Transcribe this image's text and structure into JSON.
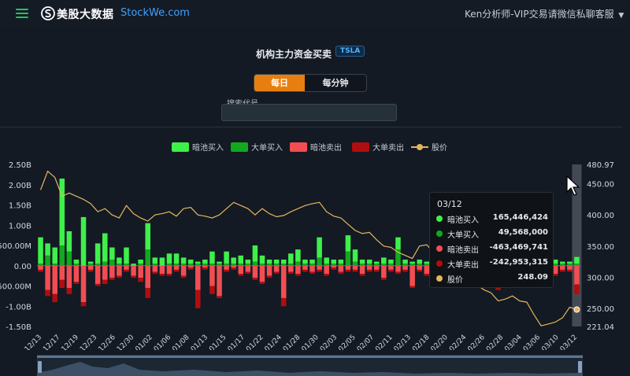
{
  "header": {
    "brand": "美股大数据",
    "site": "StockWe.com",
    "right_text": "Ken分析师-VIP交易请微信私聊客服",
    "menu_icon": "hamburger-icon",
    "logo_icon": "s-logo-icon"
  },
  "page": {
    "title": "机构主力资金买卖",
    "ticker": "TSLA",
    "tabs": [
      "每日",
      "每分钟"
    ],
    "active_tab": "每日",
    "search_label": "搜索代号",
    "search_value": ""
  },
  "colors": {
    "dark_pool_buy": "#3ef04a",
    "block_buy": "#13a81f",
    "dark_pool_sell": "#f24d53",
    "block_sell": "#b00e0e",
    "price": "#e5b55c",
    "accent": "#e77f10"
  },
  "chart_data": {
    "type": "bar",
    "legend": [
      "暗池买入",
      "大单买入",
      "暗池卖出",
      "大单卖出",
      "股价"
    ],
    "x_tick_labels": [
      "12/13",
      "12/17",
      "12/19",
      "12/23",
      "12/26",
      "12/30",
      "01/02",
      "01/06",
      "01/08",
      "01/13",
      "01/15",
      "01/17",
      "01/22",
      "01/24",
      "01/28",
      "01/30",
      "02/03",
      "02/05",
      "02/07",
      "02/11",
      "02/13",
      "02/18",
      "02/20",
      "02/24",
      "02/26",
      "02/28",
      "03/04",
      "03/06",
      "03/10",
      "03/12"
    ],
    "left_axis": {
      "ticks": [
        "2.50B",
        "2.00B",
        "1.50B",
        "1.00B",
        "500.00M",
        "0.00",
        "-500.00M",
        "-1.00B",
        "-1.50B"
      ],
      "min": -1.5,
      "max": 2.5,
      "unit": "B"
    },
    "right_axis": {
      "ticks": [
        "480.97",
        "450.00",
        "400.00",
        "350.00",
        "300.00",
        "250.00",
        "221.04"
      ],
      "min": 221.04,
      "max": 480.97
    },
    "dark_pool_buy": [
      0.65,
      0.3,
      0.4,
      1.65,
      0.5,
      0.1,
      1.2,
      0.05,
      0.5,
      0.7,
      0.3,
      0.15,
      0.4,
      0.05,
      0.1,
      0.65,
      0.15,
      0.2,
      0.25,
      0.25,
      0.15,
      0.1,
      0.05,
      0.1,
      0.3,
      0.05,
      0.3,
      0.15,
      0.2,
      0.1,
      0.4,
      0.2,
      0.1,
      0.1,
      0.1,
      0.25,
      0.3,
      0.1,
      0.1,
      0.5,
      0.15,
      0.1,
      0.1,
      0.4,
      0.3,
      0.1,
      0.1,
      0.05,
      0.15,
      0.1,
      0.3,
      0.1,
      0.05,
      0.1,
      0.05,
      0.1,
      0.1,
      0.05,
      0.1,
      0.05,
      0.05,
      0.1,
      0.3,
      0.05,
      0.05,
      0.05,
      0.05,
      0.1,
      0.1,
      0.1,
      0.1,
      0.05,
      0.1,
      0.05,
      0.05,
      0.165
    ],
    "block_buy": [
      0.05,
      0.25,
      0.05,
      0.5,
      0.35,
      0.05,
      0.0,
      0.05,
      0.05,
      0.1,
      0.15,
      0.05,
      0.05,
      0.0,
      0.05,
      0.4,
      0.05,
      0.0,
      0.05,
      0.05,
      0.05,
      0.05,
      0.05,
      0.05,
      0.05,
      0.05,
      0.05,
      0.05,
      0.05,
      0.05,
      0.1,
      0.05,
      0.05,
      0.05,
      0.05,
      0.05,
      0.1,
      0.05,
      0.05,
      0.2,
      0.05,
      0.05,
      0.05,
      0.35,
      0.1,
      0.05,
      0.05,
      0.05,
      0.05,
      0.05,
      0.4,
      0.05,
      0.05,
      0.05,
      0.05,
      0.05,
      0.05,
      0.05,
      0.05,
      0.05,
      0.05,
      0.05,
      0.5,
      0.05,
      0.05,
      0.05,
      0.05,
      0.05,
      0.05,
      0.05,
      0.05,
      0.05,
      0.05,
      0.05,
      0.05,
      0.05
    ],
    "dark_pool_sell": [
      -0.1,
      -0.6,
      -0.7,
      -0.35,
      -0.55,
      -0.4,
      -0.9,
      -0.1,
      -0.45,
      -0.35,
      -0.3,
      -0.25,
      -0.1,
      -0.25,
      -0.3,
      -0.55,
      -0.15,
      -0.2,
      -0.2,
      -0.1,
      -0.25,
      -0.05,
      -0.6,
      -0.05,
      -0.5,
      -0.75,
      -0.1,
      -0.05,
      -0.2,
      -0.15,
      -0.3,
      -0.4,
      -0.25,
      -0.15,
      -0.8,
      -0.15,
      -0.2,
      -0.1,
      -0.15,
      -0.1,
      -0.2,
      -0.05,
      -0.15,
      -0.1,
      -0.1,
      -0.2,
      -0.1,
      -0.1,
      -0.3,
      -0.1,
      -0.15,
      -0.1,
      -0.5,
      -0.1,
      -0.2,
      -0.15,
      -0.3,
      -0.1,
      -0.2,
      -0.15,
      -0.3,
      -0.2,
      -0.4,
      -0.1,
      -0.55,
      -0.45,
      -0.3,
      -0.1,
      -0.2,
      -0.15,
      -0.2,
      -0.1,
      -0.2,
      -0.1,
      -0.1,
      -0.463
    ],
    "block_sell": [
      -0.05,
      -0.15,
      -0.2,
      -0.2,
      -0.15,
      -0.05,
      -0.1,
      -0.05,
      -0.05,
      -0.1,
      -0.05,
      -0.05,
      -0.05,
      -0.05,
      -0.1,
      -0.25,
      -0.05,
      -0.05,
      -0.05,
      -0.05,
      -0.05,
      -0.05,
      -0.45,
      -0.05,
      -0.2,
      -0.05,
      -0.05,
      -0.05,
      -0.05,
      -0.05,
      -0.05,
      -0.05,
      -0.05,
      -0.05,
      -0.2,
      -0.05,
      -0.05,
      -0.05,
      -0.05,
      -0.05,
      -0.05,
      -0.05,
      -0.05,
      -0.05,
      -0.05,
      -0.05,
      -0.05,
      -0.05,
      -0.05,
      -0.05,
      -0.05,
      -0.05,
      -0.05,
      -0.05,
      -0.05,
      -0.05,
      -0.05,
      -0.05,
      -0.05,
      -0.05,
      -0.05,
      -0.05,
      -0.05,
      -0.05,
      -0.05,
      -0.05,
      -0.05,
      -0.05,
      -0.05,
      -0.05,
      -0.05,
      -0.05,
      -0.05,
      -0.05,
      -0.05,
      -0.243
    ],
    "price": [
      440,
      470,
      460,
      430,
      435,
      430,
      425,
      418,
      405,
      410,
      400,
      395,
      415,
      402,
      395,
      390,
      400,
      402,
      405,
      398,
      410,
      412,
      400,
      398,
      395,
      400,
      410,
      420,
      415,
      410,
      400,
      410,
      402,
      397,
      399,
      405,
      410,
      415,
      418,
      420,
      405,
      398,
      395,
      385,
      375,
      370,
      372,
      360,
      350,
      348,
      340,
      335,
      330,
      350,
      352,
      340,
      330,
      325,
      300,
      290,
      292,
      288,
      280,
      275,
      262,
      265,
      270,
      262,
      260,
      240,
      222,
      225,
      228,
      235,
      252,
      248.09
    ],
    "tooltip": {
      "date": "03/12",
      "rows": [
        {
          "name": "暗池买入",
          "value": "165,446,424",
          "color": "#3ef04a"
        },
        {
          "name": "大单买入",
          "value": "49,568,000",
          "color": "#13a81f"
        },
        {
          "name": "暗池卖出",
          "value": "-463,469,741",
          "color": "#f24d53"
        },
        {
          "name": "大单卖出",
          "value": "-242,953,315",
          "color": "#b00e0e"
        },
        {
          "name": "股价",
          "value": "248.09",
          "color": "#e5b55c"
        }
      ]
    }
  }
}
